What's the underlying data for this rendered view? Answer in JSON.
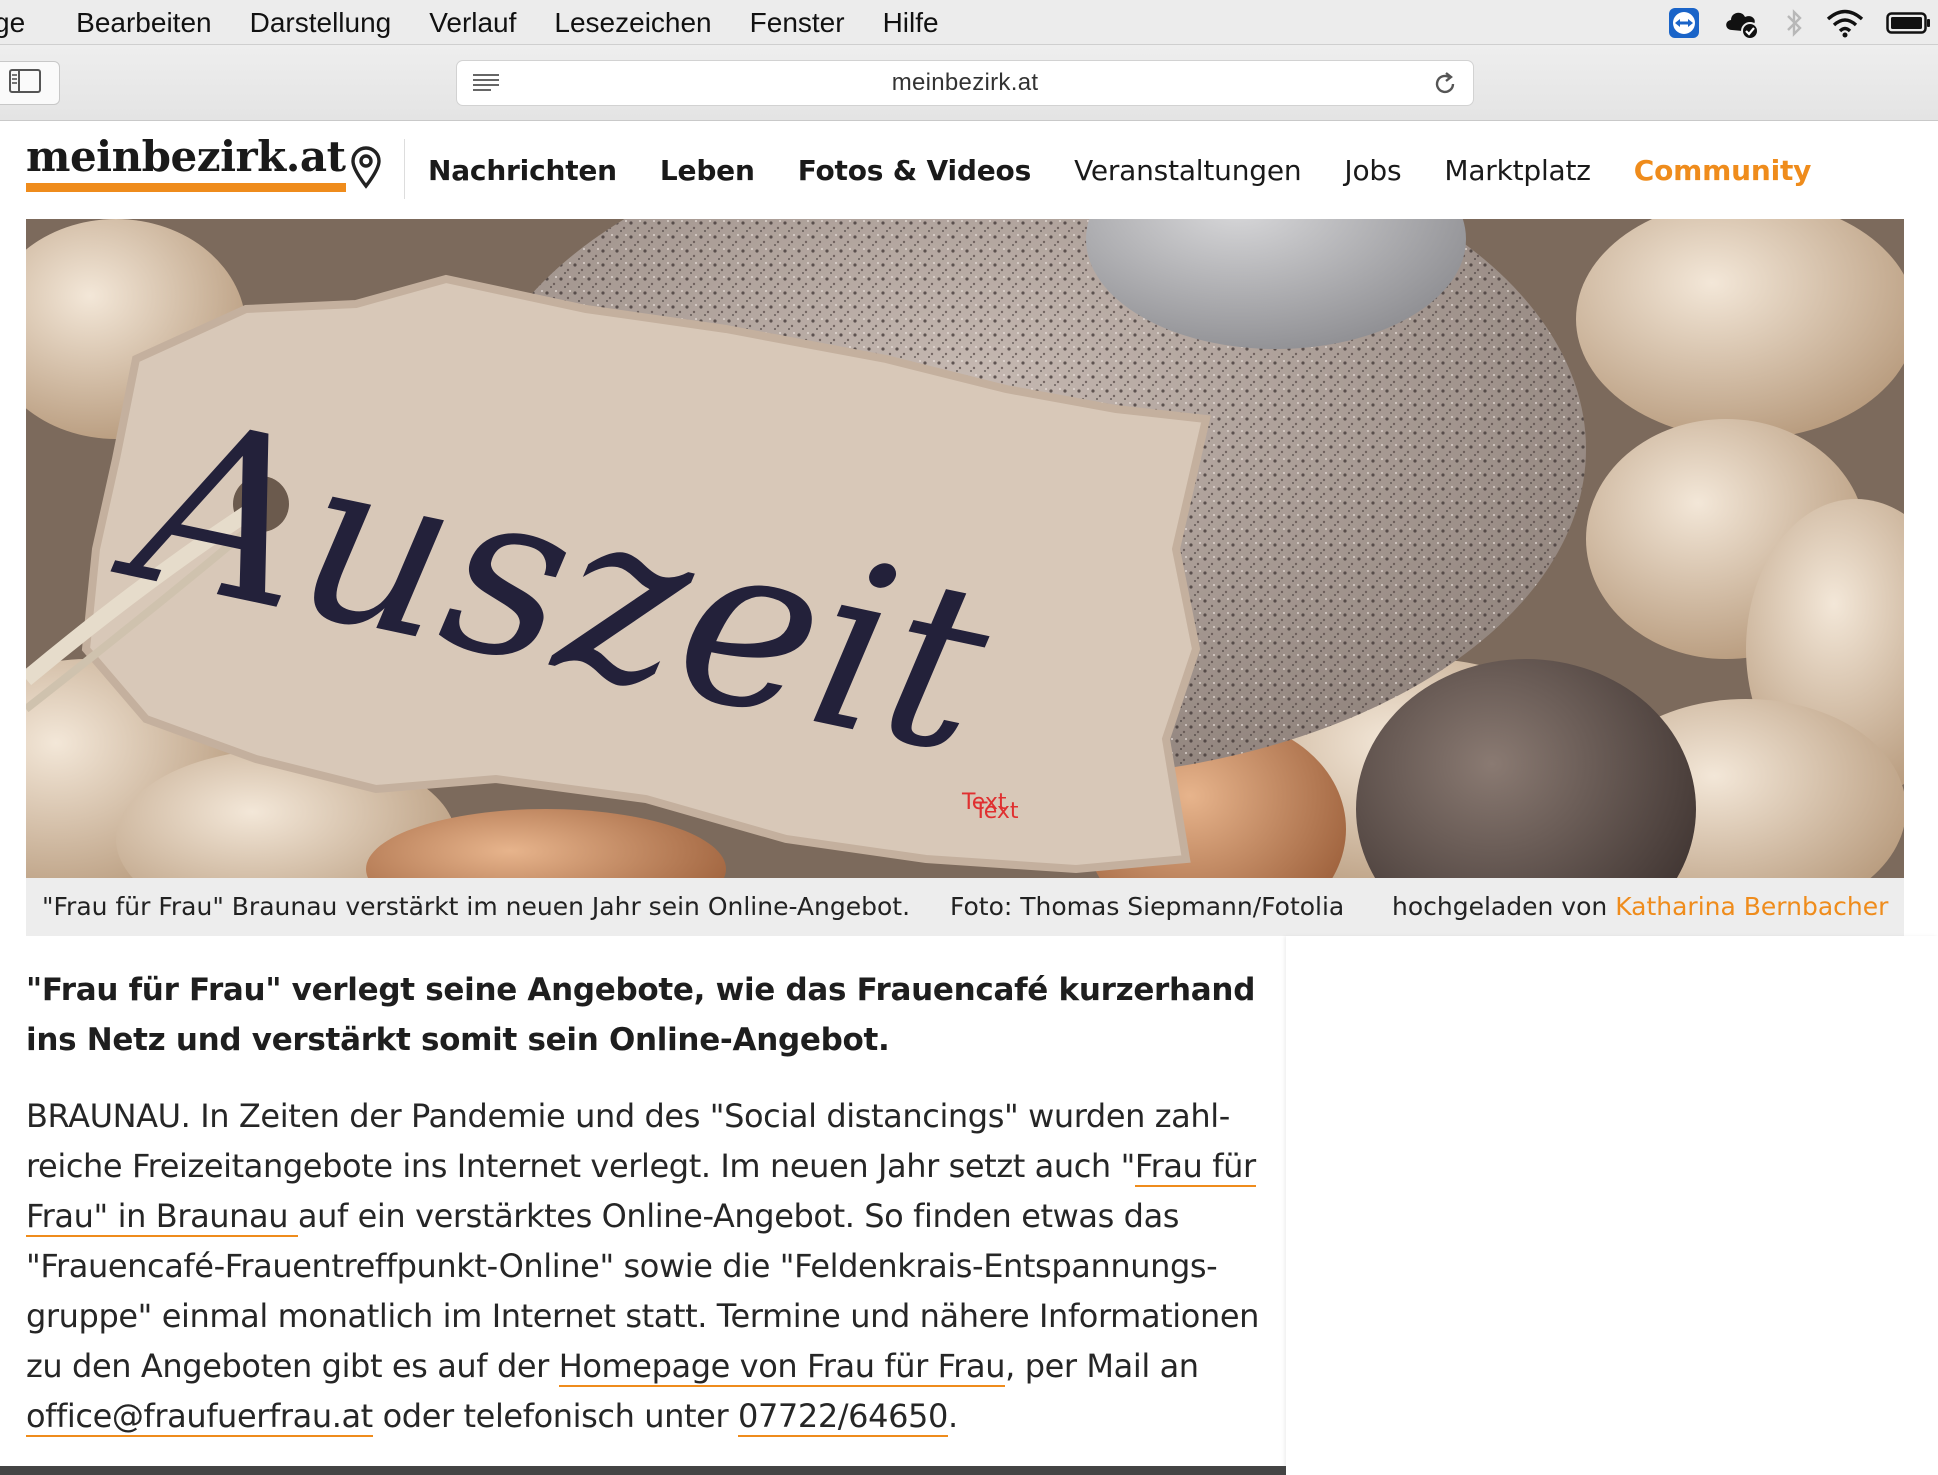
{
  "menubar": {
    "items": [
      "ge",
      "Bearbeiten",
      "Darstellung",
      "Verlauf",
      "Lesezeichen",
      "Fenster",
      "Hilfe"
    ],
    "status_icons": [
      "teamviewer-icon",
      "cloud-sync-icon",
      "bluetooth-icon",
      "wifi-icon",
      "battery-icon"
    ]
  },
  "browser": {
    "url": "meinbezirk.at"
  },
  "site": {
    "logo": "meinbezirk.at",
    "nav": [
      "Nachrichten",
      "Leben",
      "Fotos & Videos",
      "Veranstaltungen",
      "Jobs",
      "Marktplatz",
      "Community"
    ],
    "accent_color": "#ef8c1c"
  },
  "hero": {
    "tag_text": "Auszeit",
    "overlay_text": [
      "Text",
      "Text"
    ]
  },
  "caption": {
    "text": "\"Frau für Frau\" Braunau verstärkt im neuen Jahr sein Online-Angebot.",
    "photo_credit": "Foto: Thomas Siepmann/Fotolia",
    "uploaded_prefix": "hochgeladen von",
    "uploaded_by": "Katharina Bernbacher"
  },
  "article": {
    "lead": "\"Frau für Frau\" verlegt seine Angebote, wie das Frauencafé kurzerhand ins Netz und verstärkt somit sein Online-Angebot.",
    "body": {
      "p1": "BRAUNAU. In Zeiten der Pandemie und des \"Social distancings\" wurden zahl­reiche Freizeitangebote ins Internet verlegt. Im neuen Jahr setzt auch \"",
      "link1": "Frau für Frau\" in Braunau ",
      "p2": "auf ein verstärktes Online-Angebot. So finden etwas das \"Frauencafé-Frauentreffpunkt-Online\" sowie die \"Feldenkrais-Entspannungs­gruppe\" einmal monatlich im Internet statt. Termine und nähere Informatio­nen zu den Angeboten gibt es auf der ",
      "link2": "Homepage von Frau für Frau",
      "p3": ", per Mail an ",
      "link3": "office@fraufuerfrau.at",
      "p4": " oder telefonisch unter ",
      "link4": "07722/64650",
      "p5": "."
    }
  }
}
